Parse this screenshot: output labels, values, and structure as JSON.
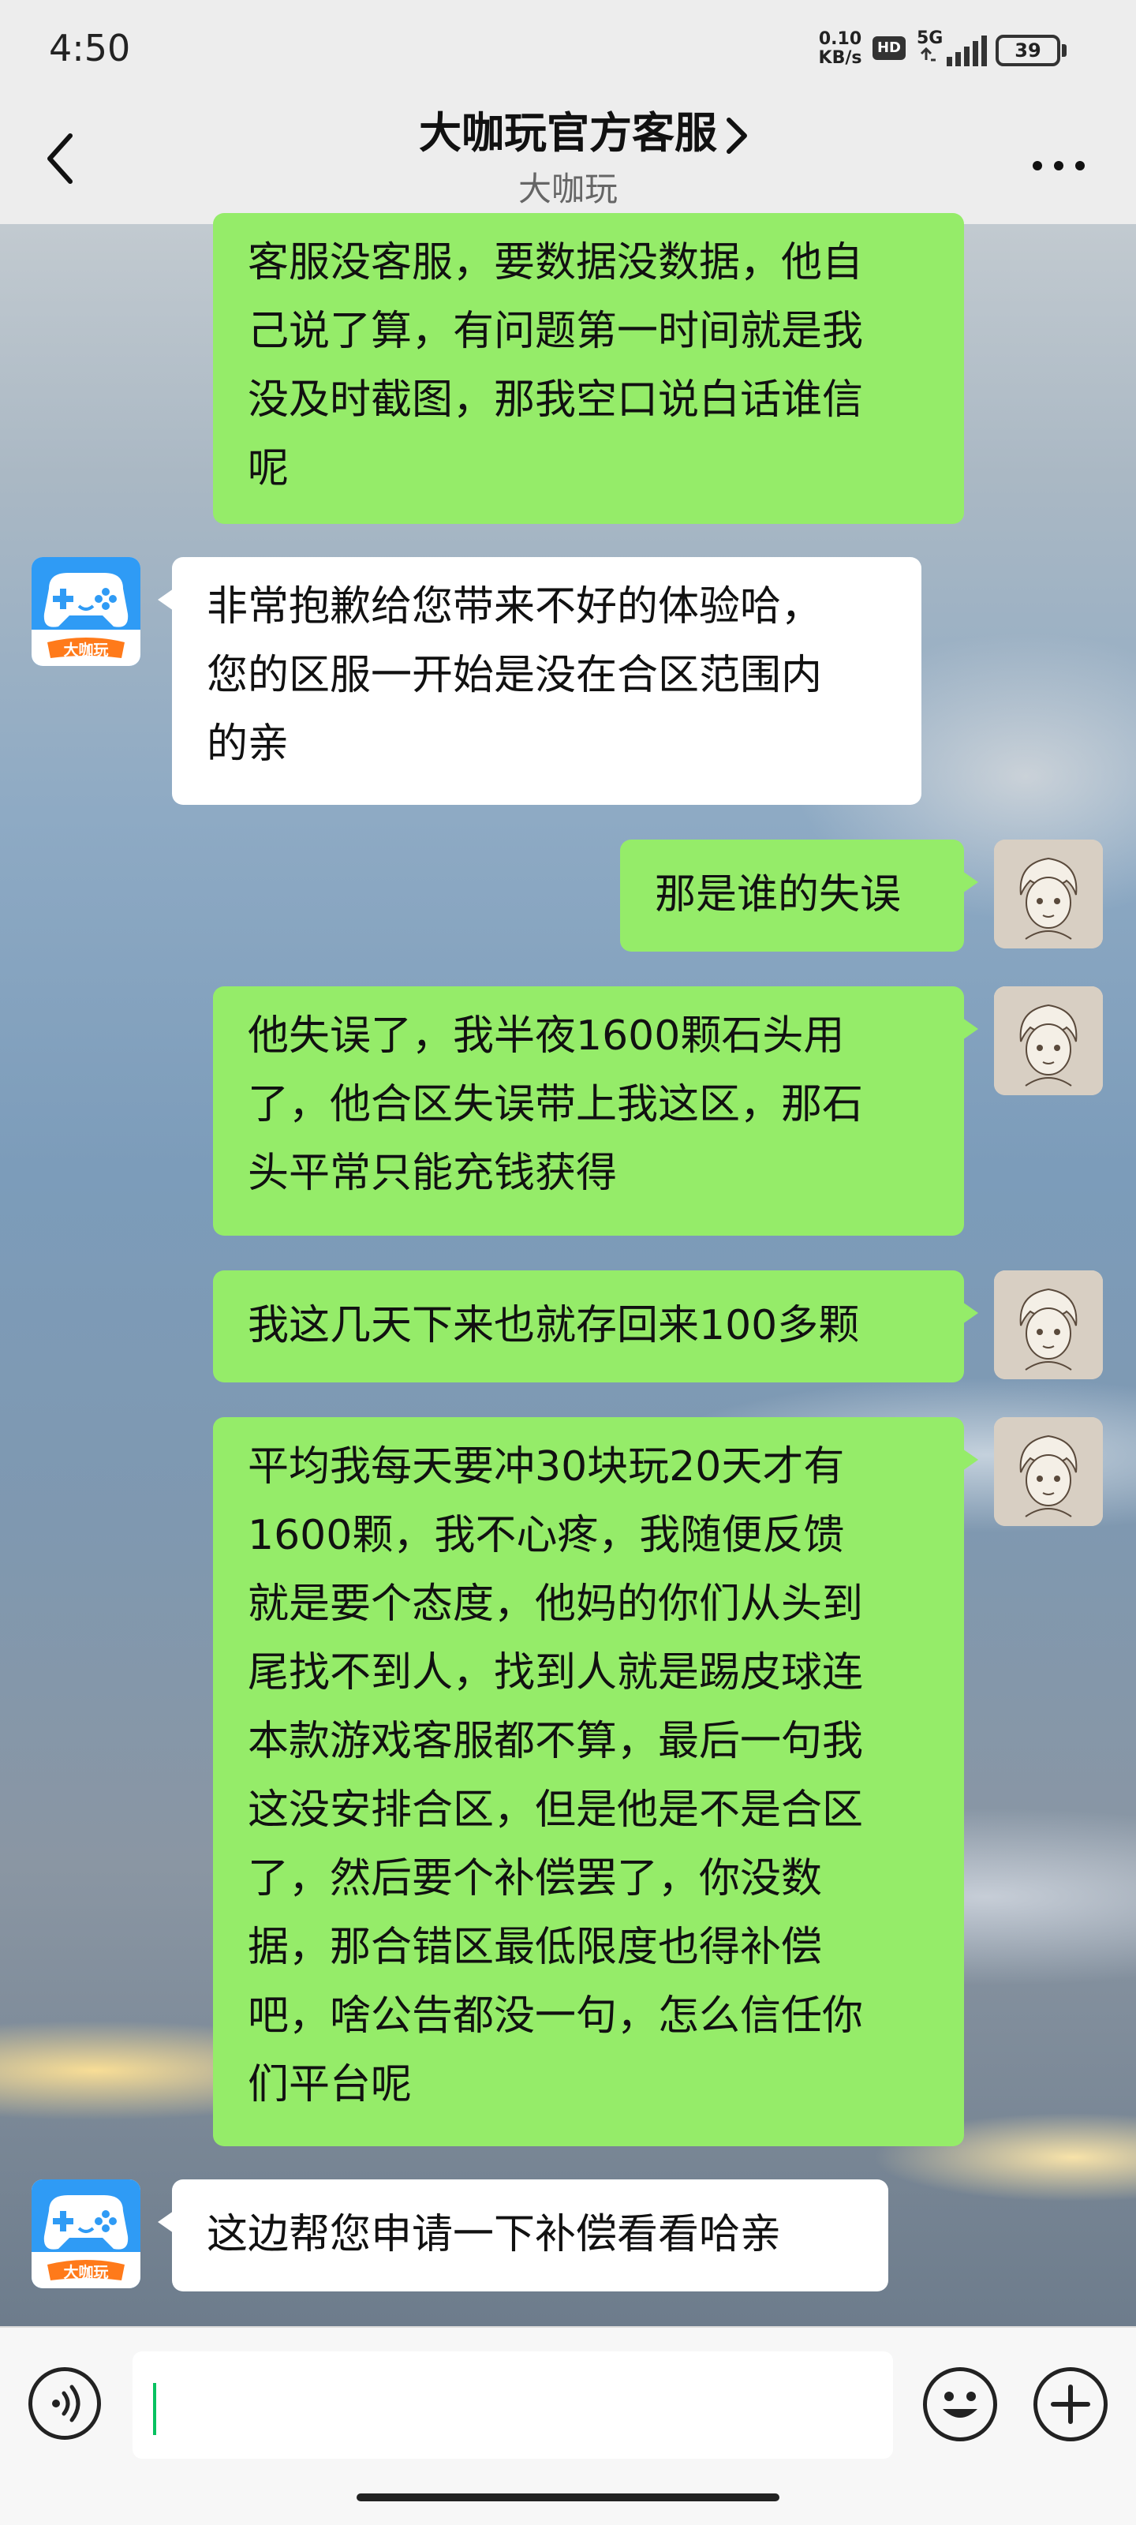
{
  "status_bar": {
    "time": "4:50",
    "net_speed_value": "0.10",
    "net_speed_unit": "KB/s",
    "hd_badge": "HD",
    "network_type": "5G",
    "battery_level": "39"
  },
  "header": {
    "title": "大咖玩官方客服",
    "subtitle": "大咖玩"
  },
  "messages": [
    {
      "sender": "me",
      "text": "客服没客服，要数据没数据，他自\n己说了算，有问题第一时间就是我\n没及时截图，那我空口说白话谁信\n呢"
    },
    {
      "sender": "them",
      "text": "非常抱歉给您带来不好的体验哈，\n您的区服一开始是没在合区范围内\n的亲"
    },
    {
      "sender": "me",
      "text": "那是谁的失误"
    },
    {
      "sender": "me",
      "text": "他失误了，我半夜1600颗石头用\n了，他合区失误带上我这区，那石\n头平常只能充钱获得"
    },
    {
      "sender": "me",
      "text": "我这几天下来也就存回来100多颗"
    },
    {
      "sender": "me",
      "text": "平均我每天要冲30块玩20天才有\n1600颗，我不心疼，我随便反馈\n就是要个态度，他妈的你们从头到\n尾找不到人，找到人就是踢皮球连\n本款游戏客服都不算，最后一句我\n这没安排合区，但是他是不是合区\n了，然后要个补偿罢了，你没数\n据，那合错区最低限度也得补偿\n吧，啥公告都没一句，怎么信任你\n们平台呢"
    },
    {
      "sender": "them",
      "text": "这边帮您申请一下补偿看看哈亲"
    }
  ],
  "app_avatar": {
    "logo_text": "大咖玩"
  },
  "colors": {
    "my_bubble": "#95ec69",
    "their_bubble": "#ffffff",
    "cursor": "#07c160",
    "app_icon_blue": "#2f9bf5",
    "app_icon_orange": "#ff7a1a"
  },
  "input": {
    "value": ""
  }
}
